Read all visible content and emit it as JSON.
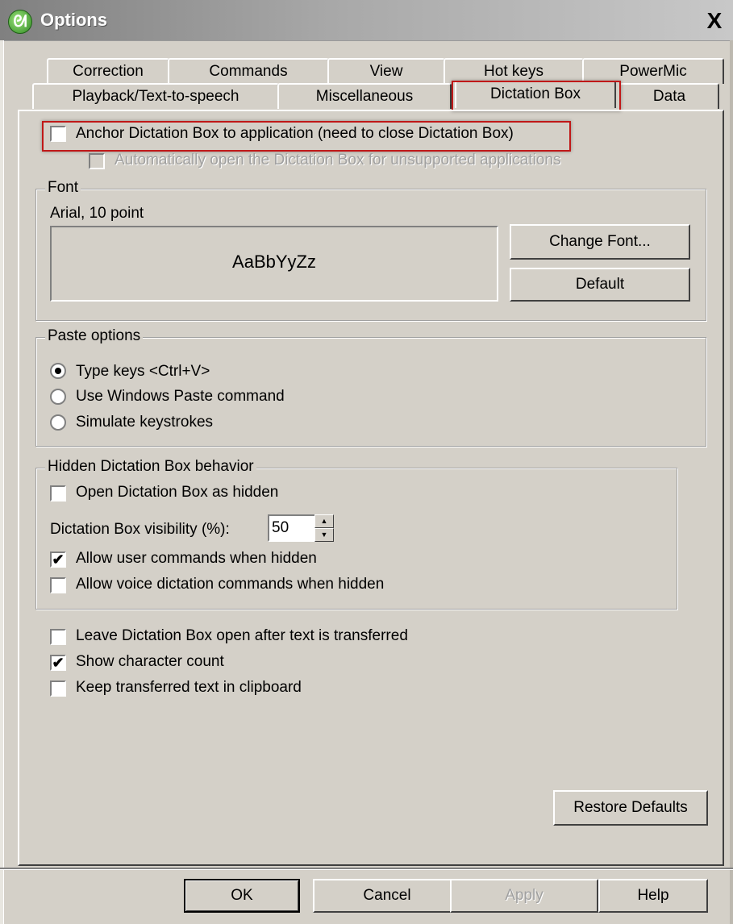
{
  "window": {
    "title": "Options",
    "close_glyph": "X",
    "icon": "dragon-icon"
  },
  "tabs": {
    "row1": [
      "Correction",
      "Commands",
      "View",
      "Hot keys",
      "PowerMic"
    ],
    "row2": [
      "Playback/Text-to-speech",
      "Miscellaneous",
      "Dictation Box",
      "Data"
    ],
    "selected": "Dictation Box"
  },
  "options": {
    "anchor_label": "Anchor Dictation Box to application (need to close Dictation Box)",
    "anchor_checked": false,
    "auto_open_label": "Automatically open the Dictation Box for unsupported applications",
    "auto_open_checked": false,
    "auto_open_enabled": false
  },
  "font_group": {
    "title": "Font",
    "font_name": "Arial, 10 point",
    "preview": "AaBbYyZz",
    "change_font_label": "Change Font...",
    "default_label": "Default"
  },
  "paste_group": {
    "title": "Paste options",
    "options": [
      "Type keys <Ctrl+V>",
      "Use Windows Paste command",
      "Simulate keystrokes"
    ],
    "selected": "Type keys <Ctrl+V>"
  },
  "hidden_group": {
    "title": "Hidden Dictation Box behavior",
    "open_hidden_label": "Open Dictation Box as hidden",
    "open_hidden_checked": false,
    "visibility_label": "Dictation Box visibility (%):",
    "visibility_value": "50",
    "user_commands_label": "Allow user commands when hidden",
    "user_commands_checked": true,
    "voice_commands_label": "Allow voice dictation commands when hidden",
    "voice_commands_checked": false
  },
  "bottom_options": {
    "leave_open_label": "Leave Dictation Box open after text is transferred",
    "leave_open_checked": false,
    "char_count_label": "Show character count",
    "char_count_checked": true,
    "keep_clipboard_label": "Keep transferred text in clipboard",
    "keep_clipboard_checked": false
  },
  "buttons": {
    "restore_defaults": "Restore Defaults",
    "ok": "OK",
    "cancel": "Cancel",
    "apply": "Apply",
    "help": "Help"
  },
  "check_glyph": "✔",
  "colors": {
    "highlight_box": "#c01818",
    "dialog_bg": "#d4d0c8",
    "title_gradient_start": "#808080"
  }
}
